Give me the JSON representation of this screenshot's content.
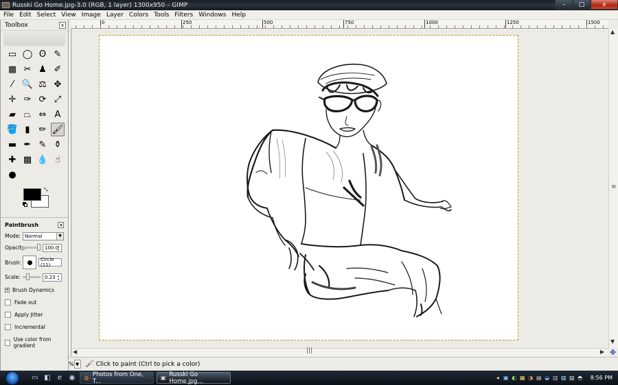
{
  "window": {
    "title": "Russki Go Home.jpg-3.0 (RGB, 1 layer) 1300x950 – GIMP",
    "minimize_glyph": "–",
    "maximize_glyph": "□",
    "close_glyph": "x"
  },
  "menu": [
    "File",
    "Edit",
    "Select",
    "View",
    "Image",
    "Layer",
    "Colors",
    "Tools",
    "Filters",
    "Windows",
    "Help"
  ],
  "ruler": {
    "labels": [
      "0",
      "250",
      "500",
      "750",
      "1000",
      "1250",
      "1500"
    ]
  },
  "toolbox": {
    "title": "Toolbox",
    "close_glyph": "x",
    "tools": [
      {
        "name": "rect-select-icon",
        "glyph": "▭"
      },
      {
        "name": "ellipse-select-icon",
        "glyph": "◯"
      },
      {
        "name": "free-select-icon",
        "glyph": "ʘ"
      },
      {
        "name": "fuzzy-select-icon",
        "glyph": "✎"
      },
      {
        "name": "select-by-color-icon",
        "glyph": "▦"
      },
      {
        "name": "scissors-icon",
        "glyph": "✂"
      },
      {
        "name": "foreground-select-icon",
        "glyph": "♟"
      },
      {
        "name": "paths-icon",
        "glyph": "✐"
      },
      {
        "name": "color-picker-icon",
        "glyph": "⁄"
      },
      {
        "name": "zoom-icon",
        "glyph": "🔍"
      },
      {
        "name": "measure-icon",
        "glyph": "⚖"
      },
      {
        "name": "move-icon",
        "glyph": "✥"
      },
      {
        "name": "align-icon",
        "glyph": "✛"
      },
      {
        "name": "crop-icon",
        "glyph": "✑"
      },
      {
        "name": "rotate-icon",
        "glyph": "⟳"
      },
      {
        "name": "scale-icon",
        "glyph": "⤢"
      },
      {
        "name": "shear-icon",
        "glyph": "▰"
      },
      {
        "name": "perspective-icon",
        "glyph": "⏢"
      },
      {
        "name": "flip-icon",
        "glyph": "⇔"
      },
      {
        "name": "text-icon",
        "glyph": "A"
      },
      {
        "name": "bucket-fill-icon",
        "glyph": "🪣"
      },
      {
        "name": "blend-icon",
        "glyph": "▮"
      },
      {
        "name": "pencil-icon",
        "glyph": "✏"
      },
      {
        "name": "paintbrush-icon",
        "glyph": "🖌"
      },
      {
        "name": "eraser-icon",
        "glyph": "▬"
      },
      {
        "name": "airbrush-icon",
        "glyph": "✒"
      },
      {
        "name": "ink-icon",
        "glyph": "✎"
      },
      {
        "name": "clone-icon",
        "glyph": "⚱"
      },
      {
        "name": "heal-icon",
        "glyph": "✚"
      },
      {
        "name": "perspective-clone-icon",
        "glyph": "▩"
      },
      {
        "name": "blur-icon",
        "glyph": "💧"
      },
      {
        "name": "smudge-icon",
        "glyph": "☝"
      },
      {
        "name": "dodge-burn-icon",
        "glyph": "●"
      }
    ],
    "active_tool": 23,
    "fg_color": "#000000",
    "bg_color": "#ffffff",
    "swap_glyph": "⤡"
  },
  "options": {
    "title": "Paintbrush",
    "menu_glyph": "◂",
    "mode_label": "Mode:",
    "mode_value": "Normal",
    "opacity_label": "Opacity:",
    "opacity_value": "100.0",
    "opacity_level": 1.0,
    "brush_label": "Brush:",
    "brush_value": "Circle (11)",
    "scale_label": "Scale:",
    "scale_value": "0.23",
    "scale_level": 0.23,
    "dynamics_label": "Brush Dynamics",
    "expander_glyph": "+",
    "checks": [
      "Fade out",
      "Apply Jitter",
      "Incremental",
      "Use color from gradient"
    ]
  },
  "scroll": {
    "up": "▲",
    "down": "▼",
    "left": "◀",
    "right": "▶",
    "grip_v": "≡",
    "grip_h": "|||",
    "navigate_glyph": "✥"
  },
  "status": {
    "zoom_suffix": "%",
    "zoom_dd": "▼",
    "tool_glyph": "🖌",
    "message": "Click to paint (Ctrl to pick a color)"
  },
  "taskbar": {
    "quicklaunch": [
      "▭",
      "◧",
      "e",
      "◉"
    ],
    "tasks": [
      {
        "label": "Photos from One, T...",
        "icon": "◍",
        "active": false
      },
      {
        "label": "Russki Go Home.jpg...",
        "icon": "▣",
        "active": true
      }
    ],
    "tray": [
      "◂",
      "▣",
      "◐",
      "▦",
      "◑",
      "▤",
      "◒",
      "▥",
      "▧",
      "▨",
      "◓"
    ],
    "clock": "8:56 PM"
  },
  "colors": {
    "selection_border": "#b8a020",
    "title_bar": "#1a1f26"
  }
}
